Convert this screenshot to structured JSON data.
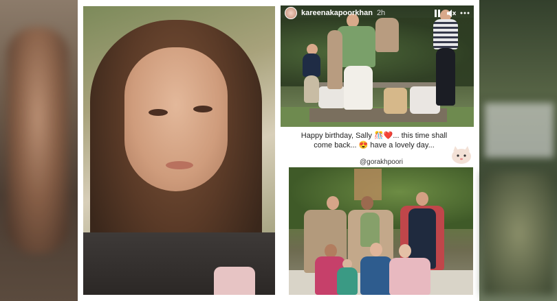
{
  "story": {
    "username": "kareenakapoorkhan",
    "time": "2h",
    "caption": "Happy birthday, Sally 🎊❤️... this time shall come back... 😍 have a lovely day...",
    "mention": "@gorakhpoori",
    "icons": [
      "pause-icon",
      "mute-icon",
      "more-icon"
    ]
  },
  "colors": {
    "background": "#ffffff",
    "text": "#222222",
    "header_text": "#ffffff"
  }
}
